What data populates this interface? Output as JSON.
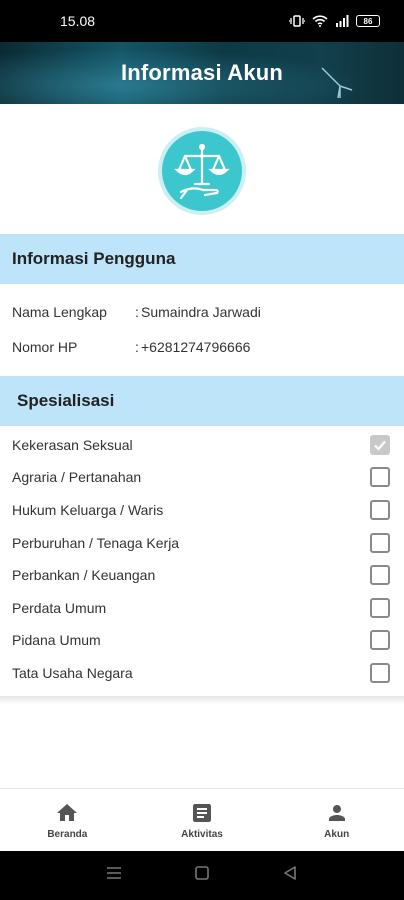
{
  "status_bar": {
    "time": "15.08",
    "battery": "86"
  },
  "header": {
    "title": "Informasi Akun"
  },
  "user_info": {
    "section_title": "Informasi Pengguna",
    "fields": [
      {
        "label": "Nama Lengkap",
        "colon": ":",
        "value": "Sumaindra Jarwadi"
      },
      {
        "label": "Nomor HP",
        "colon": ":",
        "value": "+6281274796666"
      }
    ]
  },
  "specialization": {
    "section_title": "Spesialisasi",
    "items": [
      {
        "label": "Kekerasan Seksual",
        "checked": true
      },
      {
        "label": "Agraria / Pertanahan",
        "checked": false
      },
      {
        "label": "Hukum Keluarga / Waris",
        "checked": false
      },
      {
        "label": "Perburuhan / Tenaga Kerja",
        "checked": false
      },
      {
        "label": "Perbankan / Keuangan",
        "checked": false
      },
      {
        "label": "Perdata Umum",
        "checked": false
      },
      {
        "label": "Pidana Umum",
        "checked": false
      },
      {
        "label": "Tata Usaha Negara",
        "checked": false
      }
    ]
  },
  "bottom_nav": {
    "items": [
      {
        "label": "Beranda",
        "icon": "home-icon"
      },
      {
        "label": "Aktivitas",
        "icon": "document-icon"
      },
      {
        "label": "Akun",
        "icon": "person-icon"
      }
    ]
  },
  "colors": {
    "section_bg": "#bde4f8",
    "logo_teal": "#3cc7cf",
    "header_dark": "#0d3a45"
  }
}
